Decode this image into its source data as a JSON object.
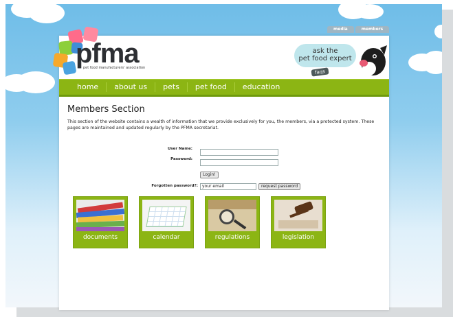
{
  "header": {
    "top_tabs": [
      "media",
      "members"
    ],
    "logo_text": "pfma",
    "logo_subtitle": "pet food manufacturers' association",
    "promo": {
      "line1": "ask the",
      "line2": "pet food expert",
      "faqs": "faqs"
    }
  },
  "nav": {
    "items": [
      "home",
      "about us",
      "pets",
      "pet food",
      "education"
    ]
  },
  "main": {
    "title": "Members Section",
    "intro": "This section of the website contains a wealth of information that we provide exclusively for you, the members, via a protected system. These pages are maintained and updated regularly by the PFMA secretariat."
  },
  "login": {
    "username_label": "User Name:",
    "password_label": "Password:",
    "username_value": "",
    "password_value": "",
    "login_button": "Login!",
    "forgot_label": "Forgotten password?:",
    "email_value": "your email",
    "request_button": "request password"
  },
  "tiles": [
    "documents",
    "calendar",
    "regulations",
    "legislation"
  ],
  "colors": {
    "accent_green": "#8cb514",
    "sky_blue": "#6fbde8",
    "text_dark": "#222222"
  }
}
